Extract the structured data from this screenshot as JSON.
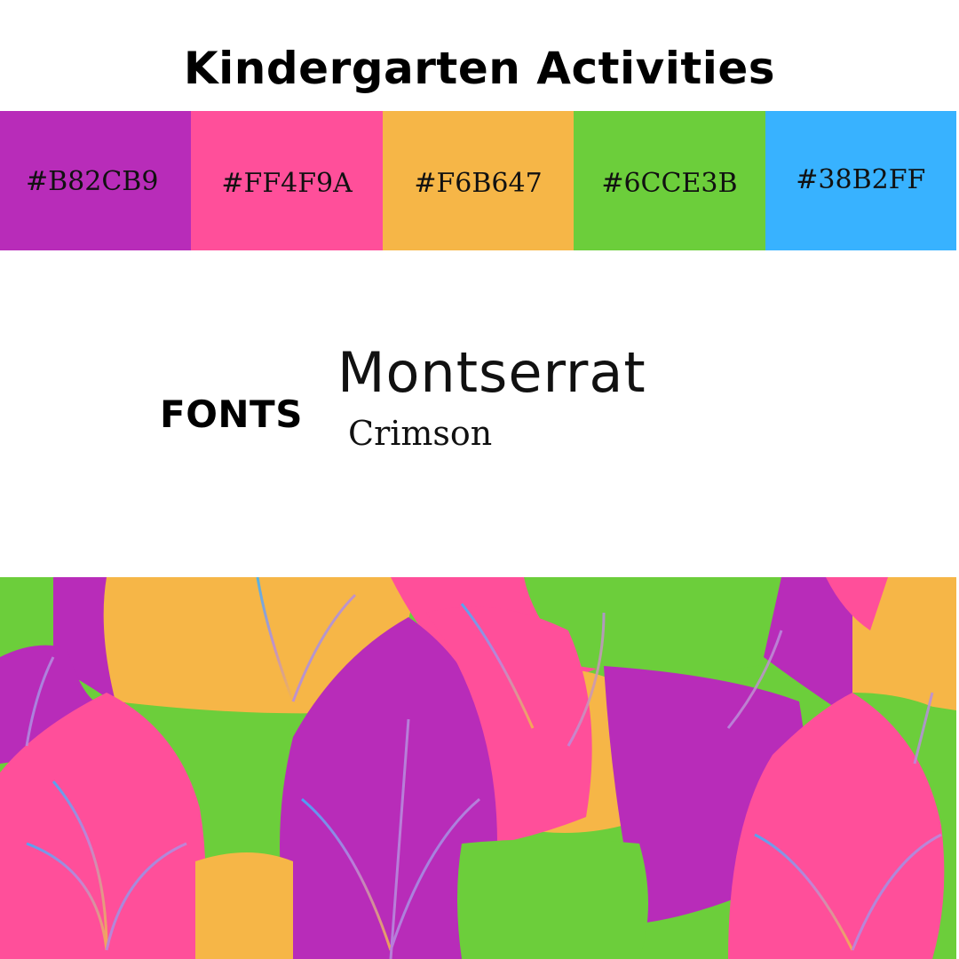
{
  "title": "Kindergarten Activities",
  "palette": [
    {
      "label": "#B82CB9",
      "color": "#B82CB9"
    },
    {
      "label": "#FF4F9A",
      "color": "#FF4F9A"
    },
    {
      "label": "#F6B647",
      "color": "#F6B647"
    },
    {
      "label": "#6CCE3B",
      "color": "#6CCE3B"
    },
    {
      "label": "#38B2FF",
      "color": "#38B2FF"
    }
  ],
  "fonts": {
    "label": "FONTS",
    "primary": "Montserrat",
    "secondary": "Crimson"
  }
}
